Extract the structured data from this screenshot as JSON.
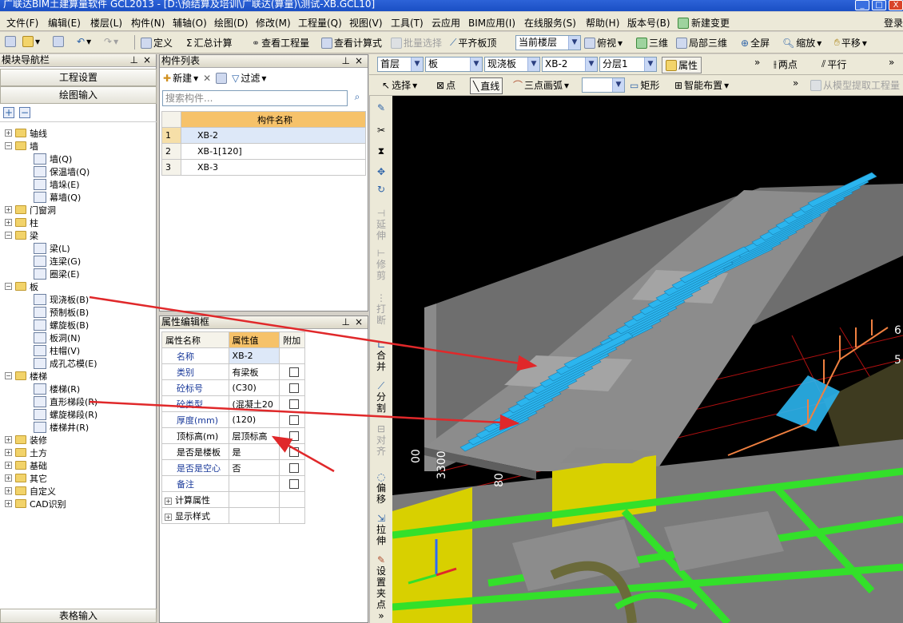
{
  "window": {
    "title": "广联达BIM土建算量软件 GCL2013 - [D:\\预结算及培训\\广联达(算量)\\测试-XB.GCL10]",
    "minimize": "_",
    "maximize": "□",
    "close": "X",
    "login": "登录"
  },
  "menu": [
    "文件(F)",
    "编辑(E)",
    "楼层(L)",
    "构件(N)",
    "辅轴(O)",
    "绘图(D)",
    "修改(M)",
    "工程量(Q)",
    "视图(V)",
    "工具(T)",
    "云应用",
    "BIM应用(I)",
    "在线服务(S)",
    "帮助(H)",
    "版本号(B)",
    "新建变更"
  ],
  "toolbar1": {
    "define": "定义",
    "summary": "汇总计算",
    "view_qty": "查看工程量",
    "view_formula": "查看计算式",
    "batch_select": "批量选择",
    "align_top": "平齐板顶",
    "current_floor": "当前楼层",
    "top_view": "俯视",
    "three_d": "三维",
    "local_3d": "局部三维",
    "fullscreen": "全屏",
    "zoom": "缩放",
    "pan": "平移"
  },
  "nav": {
    "title": "模块导航栏",
    "project_settings": "工程设置",
    "draw_input": "绘图输入",
    "table_input": "表格输入",
    "plus": "+",
    "minus": "−",
    "tree": [
      {
        "label": "轴线",
        "level": 0,
        "expander": "+"
      },
      {
        "label": "墙",
        "level": 0,
        "expander": "-"
      },
      {
        "label": "墙(Q)",
        "level": 1
      },
      {
        "label": "保温墙(Q)",
        "level": 1
      },
      {
        "label": "墙垛(E)",
        "level": 1
      },
      {
        "label": "幕墙(Q)",
        "level": 1
      },
      {
        "label": "门窗洞",
        "level": 0,
        "expander": "+"
      },
      {
        "label": "柱",
        "level": 0,
        "expander": "+"
      },
      {
        "label": "梁",
        "level": 0,
        "expander": "-"
      },
      {
        "label": "梁(L)",
        "level": 1
      },
      {
        "label": "连梁(G)",
        "level": 1
      },
      {
        "label": "圈梁(E)",
        "level": 1
      },
      {
        "label": "板",
        "level": 0,
        "expander": "-"
      },
      {
        "label": "现浇板(B)",
        "level": 1
      },
      {
        "label": "预制板(B)",
        "level": 1
      },
      {
        "label": "螺旋板(B)",
        "level": 1
      },
      {
        "label": "板洞(N)",
        "level": 1
      },
      {
        "label": "柱帽(V)",
        "level": 1
      },
      {
        "label": "成孔芯模(E)",
        "level": 1
      },
      {
        "label": "楼梯",
        "level": 0,
        "expander": "-"
      },
      {
        "label": "楼梯(R)",
        "level": 1
      },
      {
        "label": "直形梯段(R)",
        "level": 1
      },
      {
        "label": "螺旋梯段(R)",
        "level": 1
      },
      {
        "label": "楼梯井(R)",
        "level": 1
      },
      {
        "label": "装修",
        "level": 0,
        "expander": "+"
      },
      {
        "label": "土方",
        "level": 0,
        "expander": "+"
      },
      {
        "label": "基础",
        "level": 0,
        "expander": "+"
      },
      {
        "label": "其它",
        "level": 0,
        "expander": "+"
      },
      {
        "label": "自定义",
        "level": 0,
        "expander": "+"
      },
      {
        "label": "CAD识别",
        "level": 0,
        "expander": "+"
      }
    ]
  },
  "complist": {
    "title": "构件列表",
    "new": "新建",
    "filter": "过滤",
    "search_placeholder": "搜索构件...",
    "header": "构件名称",
    "rows": [
      {
        "n": "1",
        "name": "XB-2"
      },
      {
        "n": "2",
        "name": "XB-1[120]"
      },
      {
        "n": "3",
        "name": "XB-3"
      }
    ]
  },
  "props": {
    "title": "属性编辑框",
    "headers": [
      "属性名称",
      "属性值",
      "附加"
    ],
    "rows": [
      {
        "name": "名称",
        "value": "XB-2",
        "blue": true,
        "check": false
      },
      {
        "name": "类别",
        "value": "有梁板",
        "blue": true,
        "check": true
      },
      {
        "name": "砼标号",
        "value": "(C30)",
        "blue": true,
        "check": true
      },
      {
        "name": "砼类型",
        "value": "(混凝土20",
        "blue": true,
        "check": true
      },
      {
        "name": "厚度(mm)",
        "value": "(120)",
        "blue": true,
        "check": true
      },
      {
        "name": "顶标高(m)",
        "value": "层顶标高",
        "blue": false,
        "check": true
      },
      {
        "name": "是否是楼板",
        "value": "是",
        "blue": false,
        "check": true
      },
      {
        "name": "是否是空心",
        "value": "否",
        "blue": true,
        "check": true
      },
      {
        "name": "备注",
        "value": "",
        "blue": true,
        "check": true
      }
    ],
    "groups": [
      "计算属性",
      "显示样式"
    ]
  },
  "tb2": {
    "floor": "首层",
    "type": "板",
    "subtype": "现浇板",
    "comp": "XB-2",
    "layer": "分层1",
    "property": "属性",
    "two_point": "两点",
    "parallel": "平行"
  },
  "tb3": {
    "select": "选择",
    "point": "点",
    "line": "直线",
    "arc": "三点画弧",
    "rect": "矩形",
    "smart": "智能布置",
    "extract": "从模型提取工程量"
  },
  "vtools": [
    "延伸",
    "修剪",
    "打断",
    "合并",
    "分割",
    "对齐",
    "偏移",
    "拉伸",
    "设置夹点"
  ],
  "viewport": {
    "dims": [
      "3300",
      "00",
      "80"
    ],
    "side_labels": [
      "6",
      "5"
    ]
  },
  "colors": {
    "stair_blue": "#2bb5ee",
    "arrow_red": "#e0282a",
    "beam_green": "#33e02a",
    "wall_yellow": "#d8d000",
    "railing_orange": "#f08040"
  }
}
